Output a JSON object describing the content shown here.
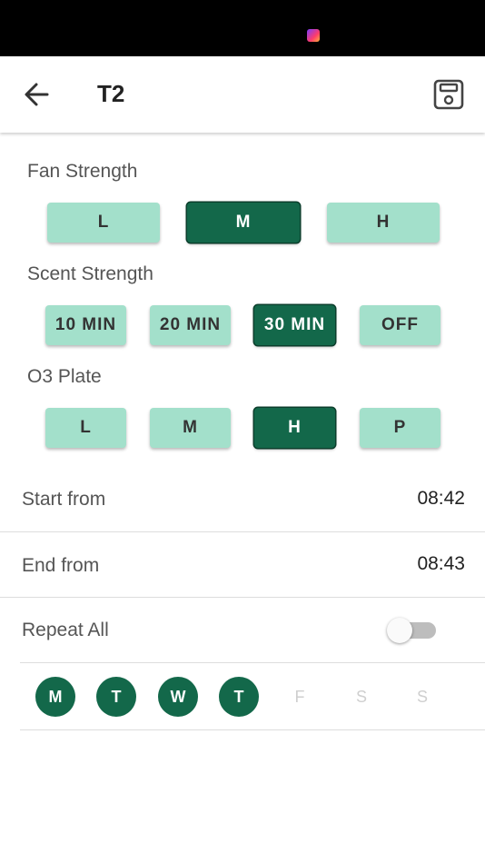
{
  "header": {
    "title": "T2",
    "back_icon": "arrow-left-icon",
    "save_icon": "save-icon"
  },
  "fan_strength": {
    "label": "Fan Strength",
    "options": [
      "L",
      "M",
      "H"
    ],
    "selected": "M"
  },
  "scent_strength": {
    "label": "Scent Strength",
    "options": [
      "10 MIN",
      "20 MIN",
      "30 MIN",
      "OFF"
    ],
    "selected": "30 MIN"
  },
  "o3_plate": {
    "label": "O3 Plate",
    "options": [
      "L",
      "M",
      "H",
      "P"
    ],
    "selected": "H"
  },
  "schedule": {
    "start_label": "Start from",
    "start_value": "08:42",
    "end_label": "End from",
    "end_value": "08:43",
    "repeat_label": "Repeat All",
    "repeat_all": false
  },
  "days": [
    {
      "label": "M",
      "active": true
    },
    {
      "label": "T",
      "active": true
    },
    {
      "label": "W",
      "active": true
    },
    {
      "label": "T",
      "active": true
    },
    {
      "label": "F",
      "active": false
    },
    {
      "label": "S",
      "active": false
    },
    {
      "label": "S",
      "active": false
    }
  ],
  "colors": {
    "accent": "#13684a",
    "option_bg": "#a3e0cb"
  }
}
